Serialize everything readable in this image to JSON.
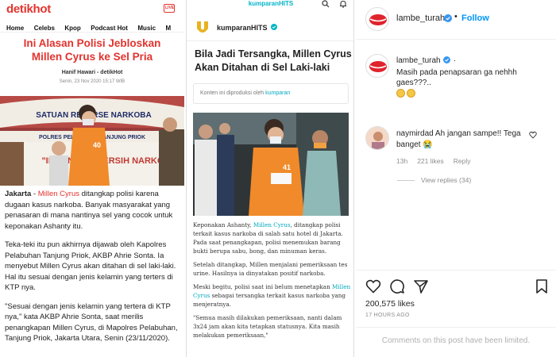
{
  "detik": {
    "logo": "detikhot",
    "live_icon": "live-tv-icon",
    "live_label": "LIVE",
    "nav": [
      "Home",
      "Celebs",
      "Kpop",
      "Podcast Hot",
      "Music",
      "M"
    ],
    "title": "Ini Alasan Polisi Jebloskan Millen Cyrus ke Sel Pria",
    "author": "Hanif Hawari - detikHot",
    "date": "Senin, 23 Nov 2020 15:17 WIB",
    "photo_sign_top": "SATUAN RESERSE NARKOBA",
    "photo_sign_mid": "POLRES PELABUHAN TANJUNG PRIOK",
    "photo_sign_bottom": "\"INDONESIA BERSIH NARKOBA\"",
    "photo_shirt": "40",
    "p1_prefix": "Jakarta",
    "p1_dash": " - ",
    "p1_link": "Millen Cyrus",
    "p1_text": " ditangkap polisi karena dugaan kasus narkoba. Banyak masyarakat yang penasaran di mana nantinya sel yang cocok untuk keponakan Ashanty itu.",
    "p2": "Teka-teki itu pun akhirnya dijawab oleh Kapolres Pelabuhan Tanjung Priok, AKBP Ahrie Sonta. Ia menyebut Millen Cyrus akan ditahan di sel laki-laki. Hal itu sesuai dengan jenis kelamin yang terters di KTP nya.",
    "p3": "\"Sesuai dengan jenis kelamin yang tertera di KTP nya,\" kata AKBP Ahrie Sonta, saat merilis penangkapan Millen Cyrus, di Mapolres Pelabuhan, Tanjung Priok, Jakarta Utara, Senin (23/11/2020)."
  },
  "kumparan": {
    "brand": "kumparanHITS",
    "search_icon": "search-icon",
    "bell_icon": "bell-icon",
    "logo_icon": "kumparan-logo-icon",
    "account": "kumparanHITS",
    "title": "Bila Jadi Tersangka, Millen Cyrus Akan Ditahan di Sel Laki-laki",
    "note_prefix": "Konten ini diproduksi oleh ",
    "note_link": "kumparan",
    "photo_shirt": "41",
    "p1_a": "Keponakan Ashanty, ",
    "p1_link": "Millen Cyrus",
    "p1_b": ", ditangkap polisi terkait kasus narkoba di salah satu hotel di Jakarta. Pada saat penangkapan, polisi menemukan barang bukti berupa sabu, bong, dan minuman keras.",
    "p2": "Setelah ditangkap, Millen menjalani pemeriksaan tes urine. Hasilnya ia dinyatakan positif narkoba.",
    "p3_a": "Meski begitu, polisi saat ini belum menetapkan ",
    "p3_link": "Millen Cyrus",
    "p3_b": " sebagai tersangka terkait kasus narkoba yang menjeratnya.",
    "p4": "\"Semua masih dilakukan pemeriksaan, nanti dalam 3x24 jam akan kita tetapkan statusnya. Kita masih melakukan pemeriksaan,\""
  },
  "instagram": {
    "username": "lambe_turah",
    "dot": "•",
    "follow": "Follow",
    "caption_user": "lambe_turah",
    "caption_tail": " .",
    "caption_text": "Masih pada penapsaran ga nehhh gaes???..",
    "comment_user": "naymirdad",
    "comment_text": " Ah jangan sampe!! Tega banget 😭",
    "comment_age": "13h",
    "comment_likes": "221 likes",
    "comment_reply": "Reply",
    "view_replies": "View replies (34)",
    "likes": "200,575 likes",
    "time": "17 HOURS AGO",
    "limited": "Comments on this post have been limited.",
    "colors": {
      "link": "#0095f6",
      "muted": "#8e8e8e",
      "red": "#e2332e",
      "teal": "#00b4c8"
    }
  }
}
